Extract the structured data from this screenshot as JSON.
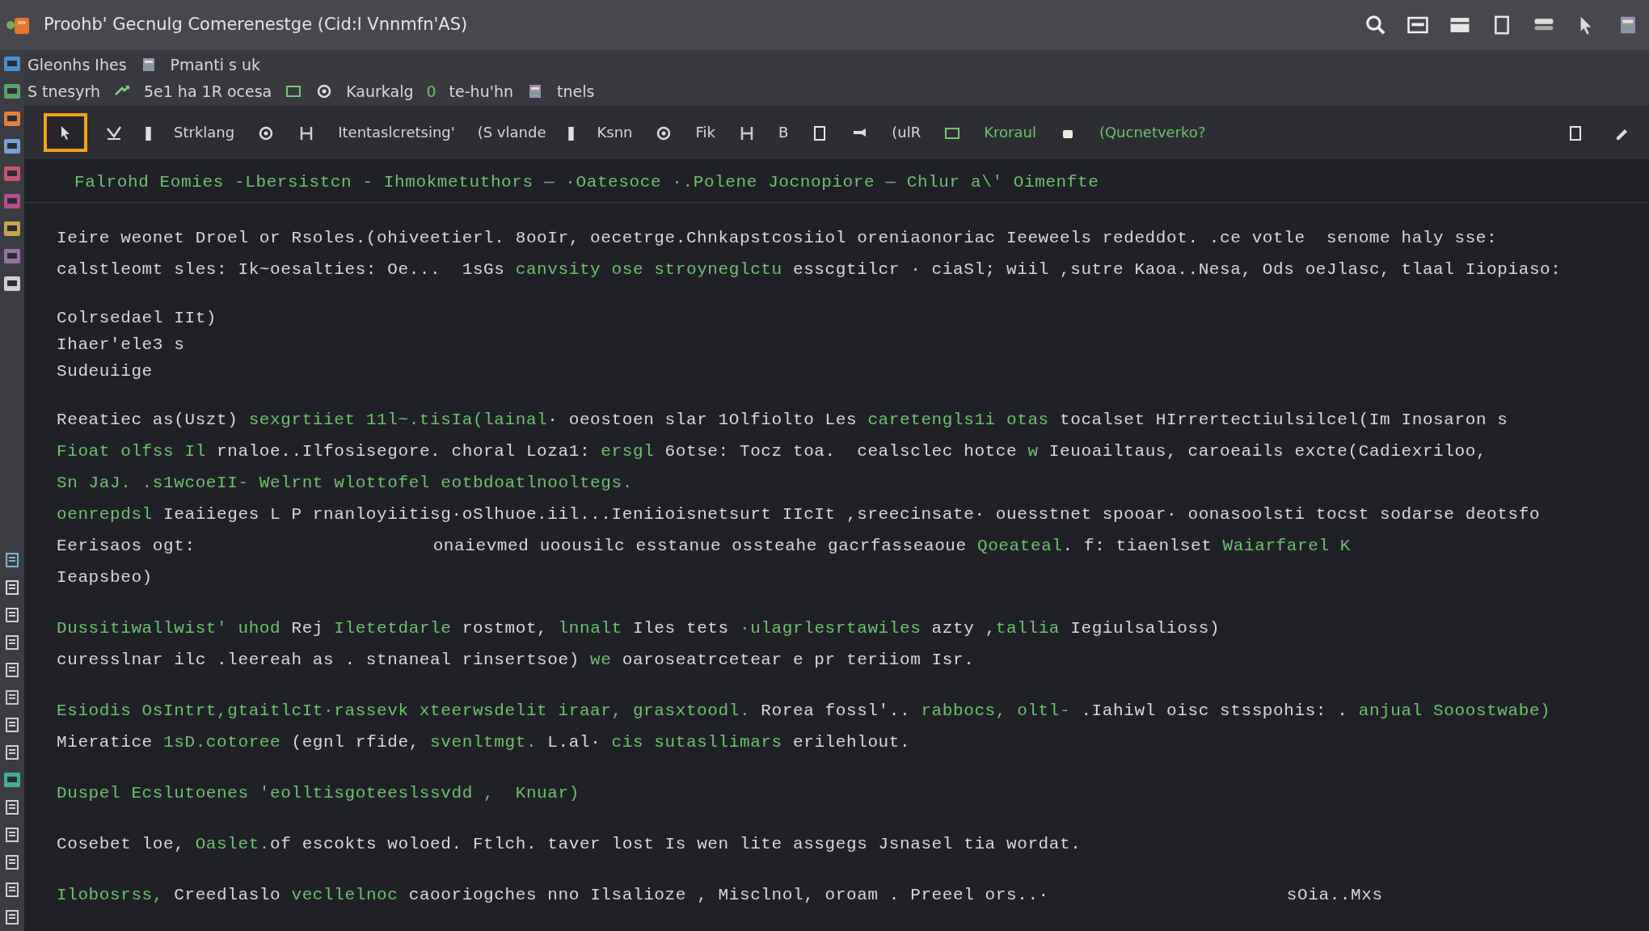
{
  "window": {
    "title": "Proohb' Gecnulg Comerenestge (Cid:l Vnnmfn'AS)"
  },
  "header": {
    "rows": [
      [
        {
          "kind": "text",
          "text": "Gleonhs Ihes",
          "accent": false
        },
        {
          "kind": "icon"
        },
        {
          "kind": "text",
          "text": "Pmanti s uk",
          "accent": false
        }
      ],
      [
        {
          "kind": "text",
          "text": "S tnesyrh",
          "accent": false
        },
        {
          "kind": "icon"
        },
        {
          "kind": "text",
          "text": "5e1 ha 1R ocesa",
          "accent": false
        },
        {
          "kind": "icon"
        },
        {
          "kind": "icon"
        },
        {
          "kind": "text",
          "text": "Kaurkalg",
          "accent": false
        },
        {
          "kind": "text",
          "text": "0",
          "accent": true
        },
        {
          "kind": "text",
          "text": "te-hu'hn",
          "accent": false
        },
        {
          "kind": "icon"
        },
        {
          "kind": "text",
          "text": "tnels",
          "accent": false
        }
      ]
    ]
  },
  "toolbar": {
    "items": [
      {
        "kind": "icon",
        "selected": true
      },
      {
        "kind": "icon",
        "selected": false
      },
      {
        "kind": "icon",
        "selected": false
      },
      {
        "kind": "text",
        "label": "Strklang",
        "accent": false,
        "selected": false
      },
      {
        "kind": "icon",
        "selected": false
      },
      {
        "kind": "icon",
        "selected": false
      },
      {
        "kind": "text",
        "label": "Itentaslcretsing'",
        "accent": false,
        "selected": false
      },
      {
        "kind": "text",
        "label": "(S vlande",
        "accent": false,
        "selected": false
      },
      {
        "kind": "icon",
        "selected": false
      },
      {
        "kind": "text",
        "label": "Ksnn",
        "accent": false,
        "selected": false
      },
      {
        "kind": "icon",
        "selected": false
      },
      {
        "kind": "text",
        "label": "Fik",
        "accent": false,
        "selected": false
      },
      {
        "kind": "icon",
        "selected": false
      },
      {
        "kind": "text",
        "label": "B",
        "accent": false,
        "selected": false
      },
      {
        "kind": "icon",
        "selected": false
      },
      {
        "kind": "icon",
        "selected": false
      },
      {
        "kind": "text",
        "label": "(ulR",
        "accent": false,
        "selected": false
      },
      {
        "kind": "icon",
        "selected": false
      },
      {
        "kind": "text",
        "label": "Kroraul",
        "accent": true,
        "selected": false
      },
      {
        "kind": "icon",
        "selected": false
      },
      {
        "kind": "text",
        "label": "(Qucnetverko?",
        "accent": true,
        "selected": false
      }
    ],
    "end_items": [
      {
        "kind": "icon"
      },
      {
        "kind": "icon"
      }
    ]
  },
  "document": {
    "heading": "Falrohd Eomies -Lbersistcn - Ihmokmetuthors — ·Oatesoce ·.Polene Jocnopiore — Chlur a\\' Oimenfte",
    "blocks": [
      {
        "kind": "paragraph",
        "lines": [
          {
            "parts": [
              [
                {
                  "text": "Ieire weonet Droel or Rsoles.(ohiveetierl. 8ooIr, oecetrge.Chnkapstcosiiol oreniaonoriac Ieeweels rededdot. .ce votle  senome haly sse:",
                  "accent": false
                }
              ]
            ]
          },
          {
            "parts": [
              [
                {
                  "text": "calstleomt sles: Ik~oesalties: Oe...  1sGs ",
                  "accent": false
                },
                {
                  "text": "canvsity ose stroyneglctu",
                  "accent": true
                },
                {
                  "text": " esscgtilcr · ciaSl; wiil ,sutre Kaoa..Nesa, Ods oeJlasc, tlaal Iiopiaso:",
                  "accent": false
                }
              ]
            ]
          }
        ]
      },
      {
        "kind": "list",
        "lines": [
          {
            "parts": [
              [
                {
                  "text": "Colrsedael IIt)",
                  "accent": false
                }
              ]
            ]
          },
          {
            "parts": [
              [
                {
                  "text": "Ihaer'ele3 s",
                  "accent": false
                }
              ]
            ]
          },
          {
            "parts": [
              [
                {
                  "text": "Sudeuiige",
                  "accent": false
                }
              ]
            ]
          }
        ]
      },
      {
        "kind": "paragraph",
        "lines": [
          {
            "parts": [
              [
                {
                  "text": "Reeatiec as(Uszt) ",
                  "accent": false
                },
                {
                  "text": "sexgrtiiet 11l~.tisIa(lainal",
                  "accent": true
                },
                {
                  "text": "· oeostoen slar 1Olfiolto Les ",
                  "accent": false
                },
                {
                  "text": "caretengls1i otas",
                  "accent": true
                },
                {
                  "text": " tocalset HIrrertectiulsilcel(Im Inosaron s",
                  "accent": false
                }
              ]
            ]
          },
          {
            "parts": [
              [
                {
                  "text": "Fioat olfss Il",
                  "accent": true
                },
                {
                  "text": " rnaloe..Ilfosisegore. choral Loza1: ",
                  "accent": false
                },
                {
                  "text": "ersgl",
                  "accent": true
                },
                {
                  "text": " 6otse: Tocz toa.  cealsclec hotce ",
                  "accent": false
                },
                {
                  "text": "w",
                  "accent": true
                },
                {
                  "text": " Ieuoailtaus, caroeails excte(Cadiexriloo,",
                  "accent": false
                }
              ]
            ]
          },
          {
            "parts": [
              [
                {
                  "text": "Sn JaJ. .s1wcoeII- Welrnt wlottofel eotbdoatlnooltegs.",
                  "accent": true
                }
              ]
            ]
          },
          {
            "parts": [
              [
                {
                  "text": "oenrepdsl ",
                  "accent": true
                },
                {
                  "text": "Ieaiieges L P rnanloyiitisg·oSlhuoe.iil...Ieniioisnetsurt IIcIt ,sreecinsate· ouesstnet spooar· oonasoolsti tocst sodarse deotsfo",
                  "accent": false
                }
              ]
            ]
          },
          {
            "parts": [
              [
                {
                  "text": "Eerisaos ogt:",
                  "accent": false
                }
              ],
              [
                {
                  "text": "onaievmed uoousilc esstanue ossteahe gacrfasseaoue ",
                  "accent": false
                },
                {
                  "text": "Qoeateal",
                  "accent": true
                },
                {
                  "text": ". f: tiaenlset ",
                  "accent": false
                },
                {
                  "text": "Waiarfarel K",
                  "accent": true
                }
              ]
            ]
          },
          {
            "parts": [
              [
                {
                  "text": "Ieapsbeo)",
                  "accent": false
                }
              ]
            ]
          }
        ]
      },
      {
        "kind": "paragraph",
        "lines": [
          {
            "parts": [
              [
                {
                  "text": "Dussitiwallwist' uhod ",
                  "accent": true
                },
                {
                  "text": "Rej ",
                  "accent": false
                },
                {
                  "text": "Iletetdarle",
                  "accent": true
                },
                {
                  "text": " rostmot, ",
                  "accent": false
                },
                {
                  "text": "lnnalt ",
                  "accent": true
                },
                {
                  "text": "Iles tets ",
                  "accent": false
                },
                {
                  "text": "·ulagrlesrtawiles",
                  "accent": true
                },
                {
                  "text": " azty ,",
                  "accent": false
                },
                {
                  "text": "tallia",
                  "accent": true
                },
                {
                  "text": " Iegiulsalioss)",
                  "accent": false
                }
              ]
            ]
          },
          {
            "parts": [
              [
                {
                  "text": "curesslnar ilc .leereah as . stnaneal rinsertsoe) ",
                  "accent": false
                },
                {
                  "text": "we",
                  "accent": true
                },
                {
                  "text": " oaroseatrcetear e pr teriiom Isr.",
                  "accent": false
                }
              ]
            ]
          }
        ]
      },
      {
        "kind": "paragraph",
        "lines": [
          {
            "parts": [
              [
                {
                  "text": "Esiodis OsIntrt,gtaitlcIt·rassevk xteerwsdelit iraar, grasxtoodl.",
                  "accent": true
                },
                {
                  "text": " Rorea fossl'.. ",
                  "accent": false
                },
                {
                  "text": "rabbocs, oltl-",
                  "accent": true
                },
                {
                  "text": " .Iahiwl oisc stsspohis: . ",
                  "accent": false
                },
                {
                  "text": "anjual Sooostwabe)",
                  "accent": true
                }
              ]
            ]
          },
          {
            "parts": [
              [
                {
                  "text": "Mieratice ",
                  "accent": false
                },
                {
                  "text": "1sD.cotoree",
                  "accent": true
                },
                {
                  "text": " (egnl rfide, ",
                  "accent": false
                },
                {
                  "text": "svenltmgt.",
                  "accent": true
                },
                {
                  "text": " L.al· ",
                  "accent": false
                },
                {
                  "text": "cis sutasllimars ",
                  "accent": true
                },
                {
                  "text": "erilehlout.",
                  "accent": false
                }
              ]
            ]
          }
        ]
      },
      {
        "kind": "paragraph",
        "lines": [
          {
            "parts": [
              [
                {
                  "text": "Duspel Ecslutoenes 'eolltisgoteeslssvdd ,  Knuar)",
                  "accent": true
                }
              ]
            ]
          }
        ]
      },
      {
        "kind": "paragraph",
        "lines": [
          {
            "parts": [
              [
                {
                  "text": "Cosebet loe, ",
                  "accent": false
                },
                {
                  "text": "Oaslet.",
                  "accent": true
                },
                {
                  "text": "of escokts woloed. Ftlch. taver lost Is wen lite assgegs Jsnasel tia wordat.",
                  "accent": false
                }
              ]
            ]
          }
        ]
      },
      {
        "kind": "paragraph",
        "lines": [
          {
            "parts": [
              [
                {
                  "text": "Ilobosrss, ",
                  "accent": true
                },
                {
                  "text": "Creedlaslo ",
                  "accent": false
                },
                {
                  "text": "vecllelnoc ",
                  "accent": true
                },
                {
                  "text": "caooriogches nno Ilsalioze , Misclnol, oroam . Preeel ors..·",
                  "accent": false
                }
              ],
              [
                {
                  "text": "sOia..Mxs",
                  "accent": false
                }
              ]
            ]
          }
        ]
      }
    ]
  }
}
